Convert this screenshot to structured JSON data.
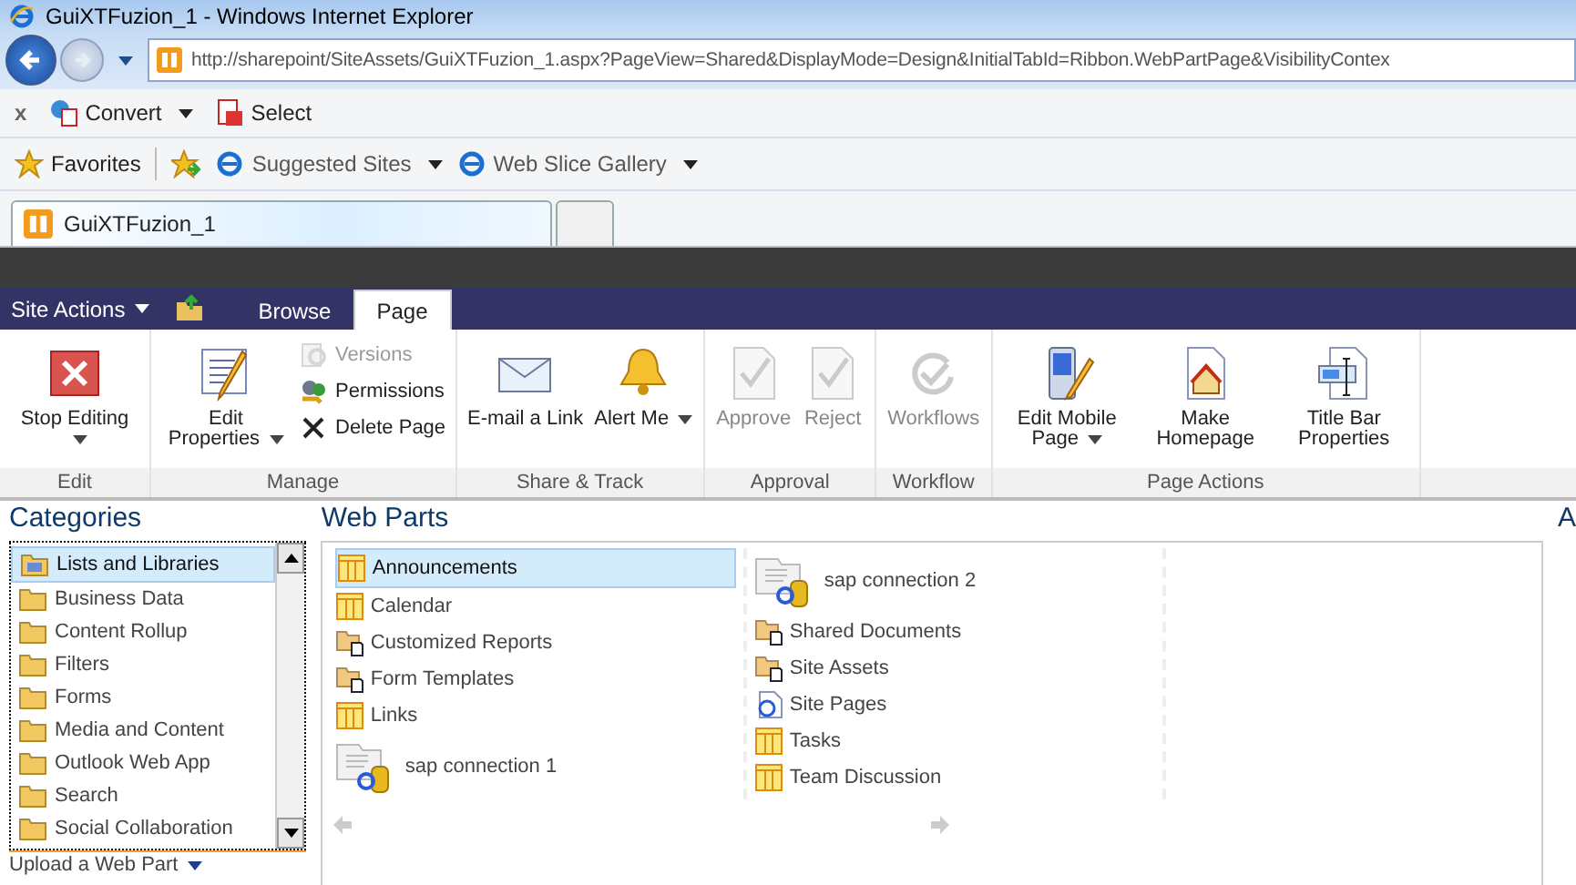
{
  "window": {
    "title": "GuiXTFuzion_1 - Windows Internet Explorer"
  },
  "address_bar": {
    "url": "http://sharepoint/SiteAssets/GuiXTFuzion_1.aspx?PageView=Shared&DisplayMode=Design&InitialTabId=Ribbon.WebPartPage&VisibilityContex"
  },
  "command_bar": {
    "close": "x",
    "items": [
      {
        "label": "Convert",
        "dropdown": true
      },
      {
        "label": "Select",
        "dropdown": false
      }
    ]
  },
  "favorites_bar": {
    "favorites": "Favorites",
    "items": [
      {
        "label": "Suggested Sites"
      },
      {
        "label": "Web Slice Gallery"
      }
    ]
  },
  "browser_tabs": [
    {
      "label": "GuiXTFuzion_1",
      "selected": true
    },
    {
      "selected": false
    }
  ],
  "ribbon": {
    "site_actions": "Site Actions",
    "tabs": [
      {
        "label": "Browse",
        "selected": false
      },
      {
        "label": "Page",
        "selected": true
      }
    ],
    "groups": [
      {
        "label": "Edit",
        "items": [
          {
            "kind": "large",
            "label": "Stop Editing",
            "dropdown": true,
            "disabled": false
          }
        ]
      },
      {
        "label": "Manage",
        "items": [
          {
            "kind": "large",
            "label": "Edit Properties",
            "dropdown": true,
            "disabled": false
          },
          {
            "kind": "stack",
            "children": [
              {
                "label": "Versions",
                "disabled": true
              },
              {
                "label": "Permissions",
                "disabled": false
              },
              {
                "label": "Delete Page",
                "disabled": false
              }
            ]
          }
        ]
      },
      {
        "label": "Share & Track",
        "items": [
          {
            "kind": "large",
            "label": "E-mail a Link",
            "dropdown": false,
            "disabled": false
          },
          {
            "kind": "large",
            "label": "Alert Me",
            "dropdown": true,
            "disabled": false
          }
        ]
      },
      {
        "label": "Approval",
        "items": [
          {
            "kind": "large",
            "label": "Approve",
            "dropdown": false,
            "disabled": true
          },
          {
            "kind": "large",
            "label": "Reject",
            "dropdown": false,
            "disabled": true
          }
        ]
      },
      {
        "label": "Workflow",
        "items": [
          {
            "kind": "large",
            "label": "Workflows",
            "dropdown": false,
            "disabled": true
          }
        ]
      },
      {
        "label": "Page Actions",
        "items": [
          {
            "kind": "large",
            "label": "Edit Mobile Page",
            "dropdown": true,
            "disabled": false
          },
          {
            "kind": "large",
            "label": "Make Homepage",
            "dropdown": false,
            "disabled": false
          },
          {
            "kind": "large",
            "label": "Title Bar Properties",
            "dropdown": false,
            "disabled": false
          }
        ]
      }
    ]
  },
  "categories": {
    "title": "Categories",
    "items": [
      {
        "label": "Lists and Libraries",
        "selected": true
      },
      {
        "label": "Business Data",
        "selected": false
      },
      {
        "label": "Content Rollup",
        "selected": false
      },
      {
        "label": "Filters",
        "selected": false
      },
      {
        "label": "Forms",
        "selected": false
      },
      {
        "label": "Media and Content",
        "selected": false
      },
      {
        "label": "Outlook Web App",
        "selected": false
      },
      {
        "label": "Search",
        "selected": false
      },
      {
        "label": "Social Collaboration",
        "selected": false
      }
    ],
    "upload": "Upload a Web Part"
  },
  "web_parts": {
    "title": "Web Parts",
    "columns": [
      [
        {
          "kind": "list",
          "label": "Announcements",
          "selected": true
        },
        {
          "kind": "list",
          "label": "Calendar",
          "selected": false
        },
        {
          "kind": "library",
          "label": "Customized Reports",
          "selected": false
        },
        {
          "kind": "library",
          "label": "Form Templates",
          "selected": false
        },
        {
          "kind": "list",
          "label": "Links",
          "selected": false
        },
        {
          "kind": "external",
          "label": "sap connection 1",
          "selected": false
        }
      ],
      [
        {
          "kind": "external",
          "label": "sap connection 2",
          "selected": false
        },
        {
          "kind": "library",
          "label": "Shared Documents",
          "selected": false
        },
        {
          "kind": "library",
          "label": "Site Assets",
          "selected": false
        },
        {
          "kind": "pages",
          "label": "Site Pages",
          "selected": false
        },
        {
          "kind": "list",
          "label": "Tasks",
          "selected": false
        },
        {
          "kind": "list",
          "label": "Team Discussion",
          "selected": false
        }
      ]
    ]
  },
  "panel_3": {
    "heading": "A"
  }
}
